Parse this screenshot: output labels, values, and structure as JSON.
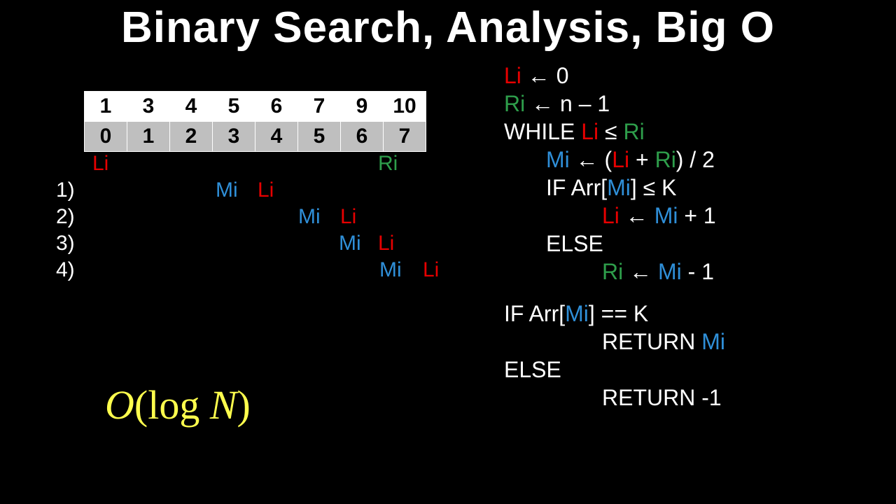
{
  "title": "Binary Search, Analysis, Big O",
  "array_values": [
    "1",
    "3",
    "4",
    "5",
    "6",
    "7",
    "9",
    "10"
  ],
  "array_indices": [
    "0",
    "1",
    "2",
    "3",
    "4",
    "5",
    "6",
    "7"
  ],
  "labels": {
    "Li": "Li",
    "Ri": "Ri",
    "Mi": "Mi"
  },
  "steps": [
    "1)",
    "2)",
    "3)",
    "4)"
  ],
  "bigO": {
    "O": "O",
    "open": "(",
    "log": "log",
    "N": "N",
    "close": ")"
  },
  "pseudo": {
    "l1a": "Li",
    "l1b": " ← 0",
    "l2a": "Ri",
    "l2b": " ← n – 1",
    "l3a": "WHILE ",
    "l3b": "Li",
    "l3c": " ≤ ",
    "l3d": "Ri",
    "l4a": "Mi",
    "l4b": " ← (",
    "l4c": "Li",
    "l4d": " + ",
    "l4e": "Ri",
    "l4f": ") / 2",
    "l5a": "IF Arr[",
    "l5b": "Mi",
    "l5c": "] ≤ K",
    "l6a": "Li",
    "l6b": " ← ",
    "l6c": "Mi",
    "l6d": " + 1",
    "l7": "ELSE",
    "l8a": "Ri",
    "l8b": " ← ",
    "l8c": "Mi",
    "l8d": " - 1",
    "l9a": "IF Arr[",
    "l9b": "Mi",
    "l9c": "] == K",
    "l10a": "RETURN ",
    "l10b": "Mi",
    "l11": "ELSE",
    "l12": "RETURN -1"
  }
}
